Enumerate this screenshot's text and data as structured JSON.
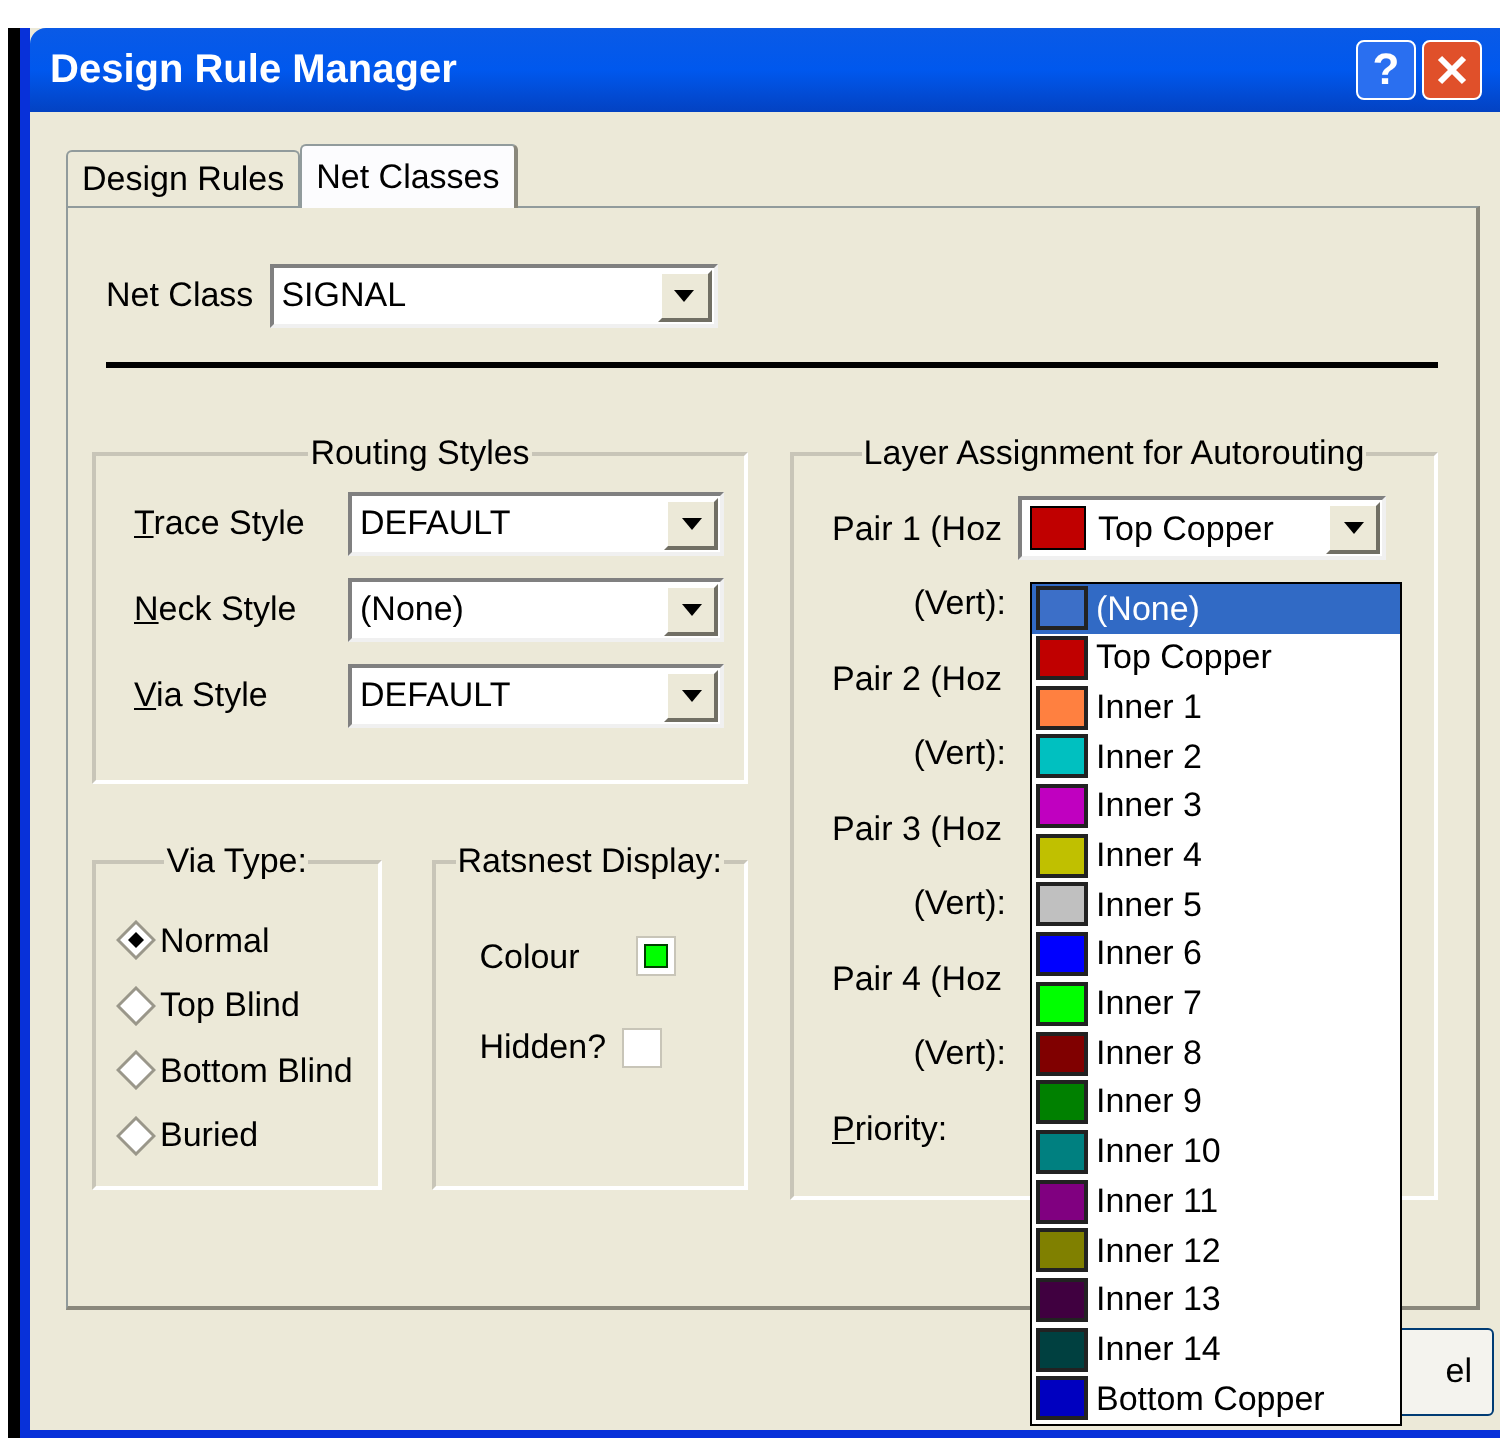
{
  "window": {
    "title": "Design Rule Manager"
  },
  "title_buttons": [
    {
      "kind": "help",
      "label": "?"
    },
    {
      "kind": "close"
    }
  ],
  "tabs": [
    {
      "label": "Design Rules",
      "selected": false
    },
    {
      "label": "Net Classes",
      "selected": true
    }
  ],
  "net_class": {
    "label": "Net Class",
    "value": "SIGNAL"
  },
  "routing_styles": {
    "title": "Routing Styles",
    "fields": [
      {
        "label": "Trace Style",
        "underline_first": true,
        "value": "DEFAULT"
      },
      {
        "label": "Neck Style",
        "underline_first": true,
        "value": "(None)"
      },
      {
        "label": "Via Style",
        "underline_first": true,
        "value": "DEFAULT"
      }
    ]
  },
  "via_type": {
    "title": "Via Type:",
    "options": [
      {
        "label": "Normal",
        "selected": true
      },
      {
        "label": "Top Blind",
        "selected": false
      },
      {
        "label": "Bottom Blind",
        "selected": false
      },
      {
        "label": "Buried",
        "selected": false
      }
    ]
  },
  "ratsnest": {
    "title": "Ratsnest Display:",
    "colour": {
      "label": "Colour",
      "color": "#00ff00"
    },
    "hidden": {
      "label": "Hidden?",
      "checked": false
    }
  },
  "layer_assignment": {
    "title": "Layer Assignment for Autorouting",
    "rows": [
      {
        "label": "Pair 1 (Hoz",
        "underline_first": false,
        "value": "Top Copper",
        "color": "#c00000"
      },
      {
        "label": "(Vert):",
        "underline_first": false
      },
      {
        "label": "Pair 2 (Hoz",
        "underline_first": false
      },
      {
        "label": "(Vert):",
        "underline_first": false
      },
      {
        "label": "Pair 3 (Hoz",
        "underline_first": false
      },
      {
        "label": "(Vert):",
        "underline_first": false
      },
      {
        "label": "Pair 4 (Hoz",
        "underline_first": false
      },
      {
        "label": "(Vert):",
        "underline_first": false
      },
      {
        "label": "Priority:",
        "underline_first": true
      }
    ]
  },
  "dropdown_list": [
    {
      "label": "(None)",
      "color": "#3c6fc8",
      "selected": true
    },
    {
      "label": "Top Copper",
      "color": "#c00000",
      "selected": false
    },
    {
      "label": "Inner 1",
      "color": "#ff8040",
      "selected": false
    },
    {
      "label": "Inner 2",
      "color": "#00c0c0",
      "selected": false
    },
    {
      "label": "Inner 3",
      "color": "#c000c0",
      "selected": false
    },
    {
      "label": "Inner 4",
      "color": "#c0c000",
      "selected": false
    },
    {
      "label": "Inner 5",
      "color": "#c0c0c0",
      "selected": false
    },
    {
      "label": "Inner 6",
      "color": "#0000ff",
      "selected": false
    },
    {
      "label": "Inner 7",
      "color": "#00ff00",
      "selected": false
    },
    {
      "label": "Inner 8",
      "color": "#800000",
      "selected": false
    },
    {
      "label": "Inner 9",
      "color": "#008000",
      "selected": false
    },
    {
      "label": "Inner 10",
      "color": "#008080",
      "selected": false
    },
    {
      "label": "Inner 11",
      "color": "#800080",
      "selected": false
    },
    {
      "label": "Inner 12",
      "color": "#808000",
      "selected": false
    },
    {
      "label": "Inner 13",
      "color": "#400040",
      "selected": false
    },
    {
      "label": "Inner 14",
      "color": "#004040",
      "selected": false
    },
    {
      "label": "Bottom Copper",
      "color": "#0000c0",
      "selected": false
    }
  ],
  "footer_button": {
    "label": "el"
  }
}
